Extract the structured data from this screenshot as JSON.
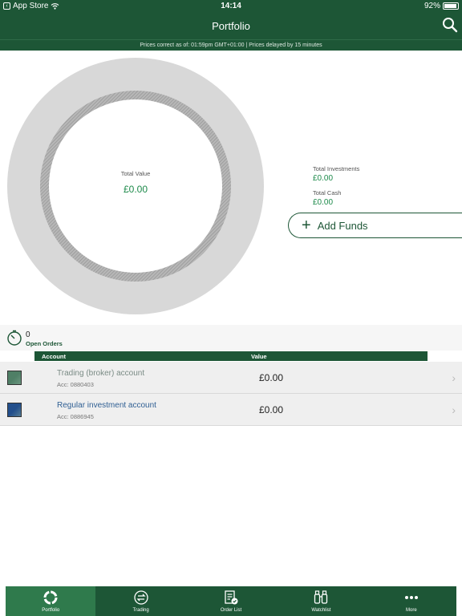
{
  "status": {
    "carrier": "App Store",
    "time": "14:14",
    "battery": "92%",
    "battery_level": 0.92
  },
  "header": {
    "title": "Portfolio"
  },
  "prices_note": "Prices correct as of: 01:59pm GMT+01:00 | Prices delayed by 15 minutes",
  "donut": {
    "label": "Total Value",
    "value": "£0.00"
  },
  "summary": {
    "investments_label": "Total Investments",
    "investments_value": "£0.00",
    "cash_label": "Total Cash",
    "cash_value": "£0.00"
  },
  "add_funds_label": "Add Funds",
  "orders": {
    "count": "0",
    "label": "Open Orders"
  },
  "table": {
    "columns": [
      "Account",
      "Value"
    ],
    "rows": [
      {
        "name": "Trading (broker) account",
        "acc": "Acc: 0880403",
        "value": "£0.00",
        "color": "#4f7f66"
      },
      {
        "name": "Regular investment account",
        "acc": "Acc: 0886945",
        "value": "£0.00",
        "color": "#234f8c"
      }
    ]
  },
  "tabs": [
    {
      "label": "Portfolio",
      "icon": "portfolio-ring-icon",
      "active": true
    },
    {
      "label": "Trading",
      "icon": "trading-arrows-icon",
      "active": false
    },
    {
      "label": "Order List",
      "icon": "order-list-icon",
      "active": false
    },
    {
      "label": "Watchlist",
      "icon": "binoculars-icon",
      "active": false
    },
    {
      "label": "More",
      "icon": "more-dots-icon",
      "active": false
    }
  ],
  "colors": {
    "brand": "#1d5636",
    "positive": "#1d8a4a"
  }
}
